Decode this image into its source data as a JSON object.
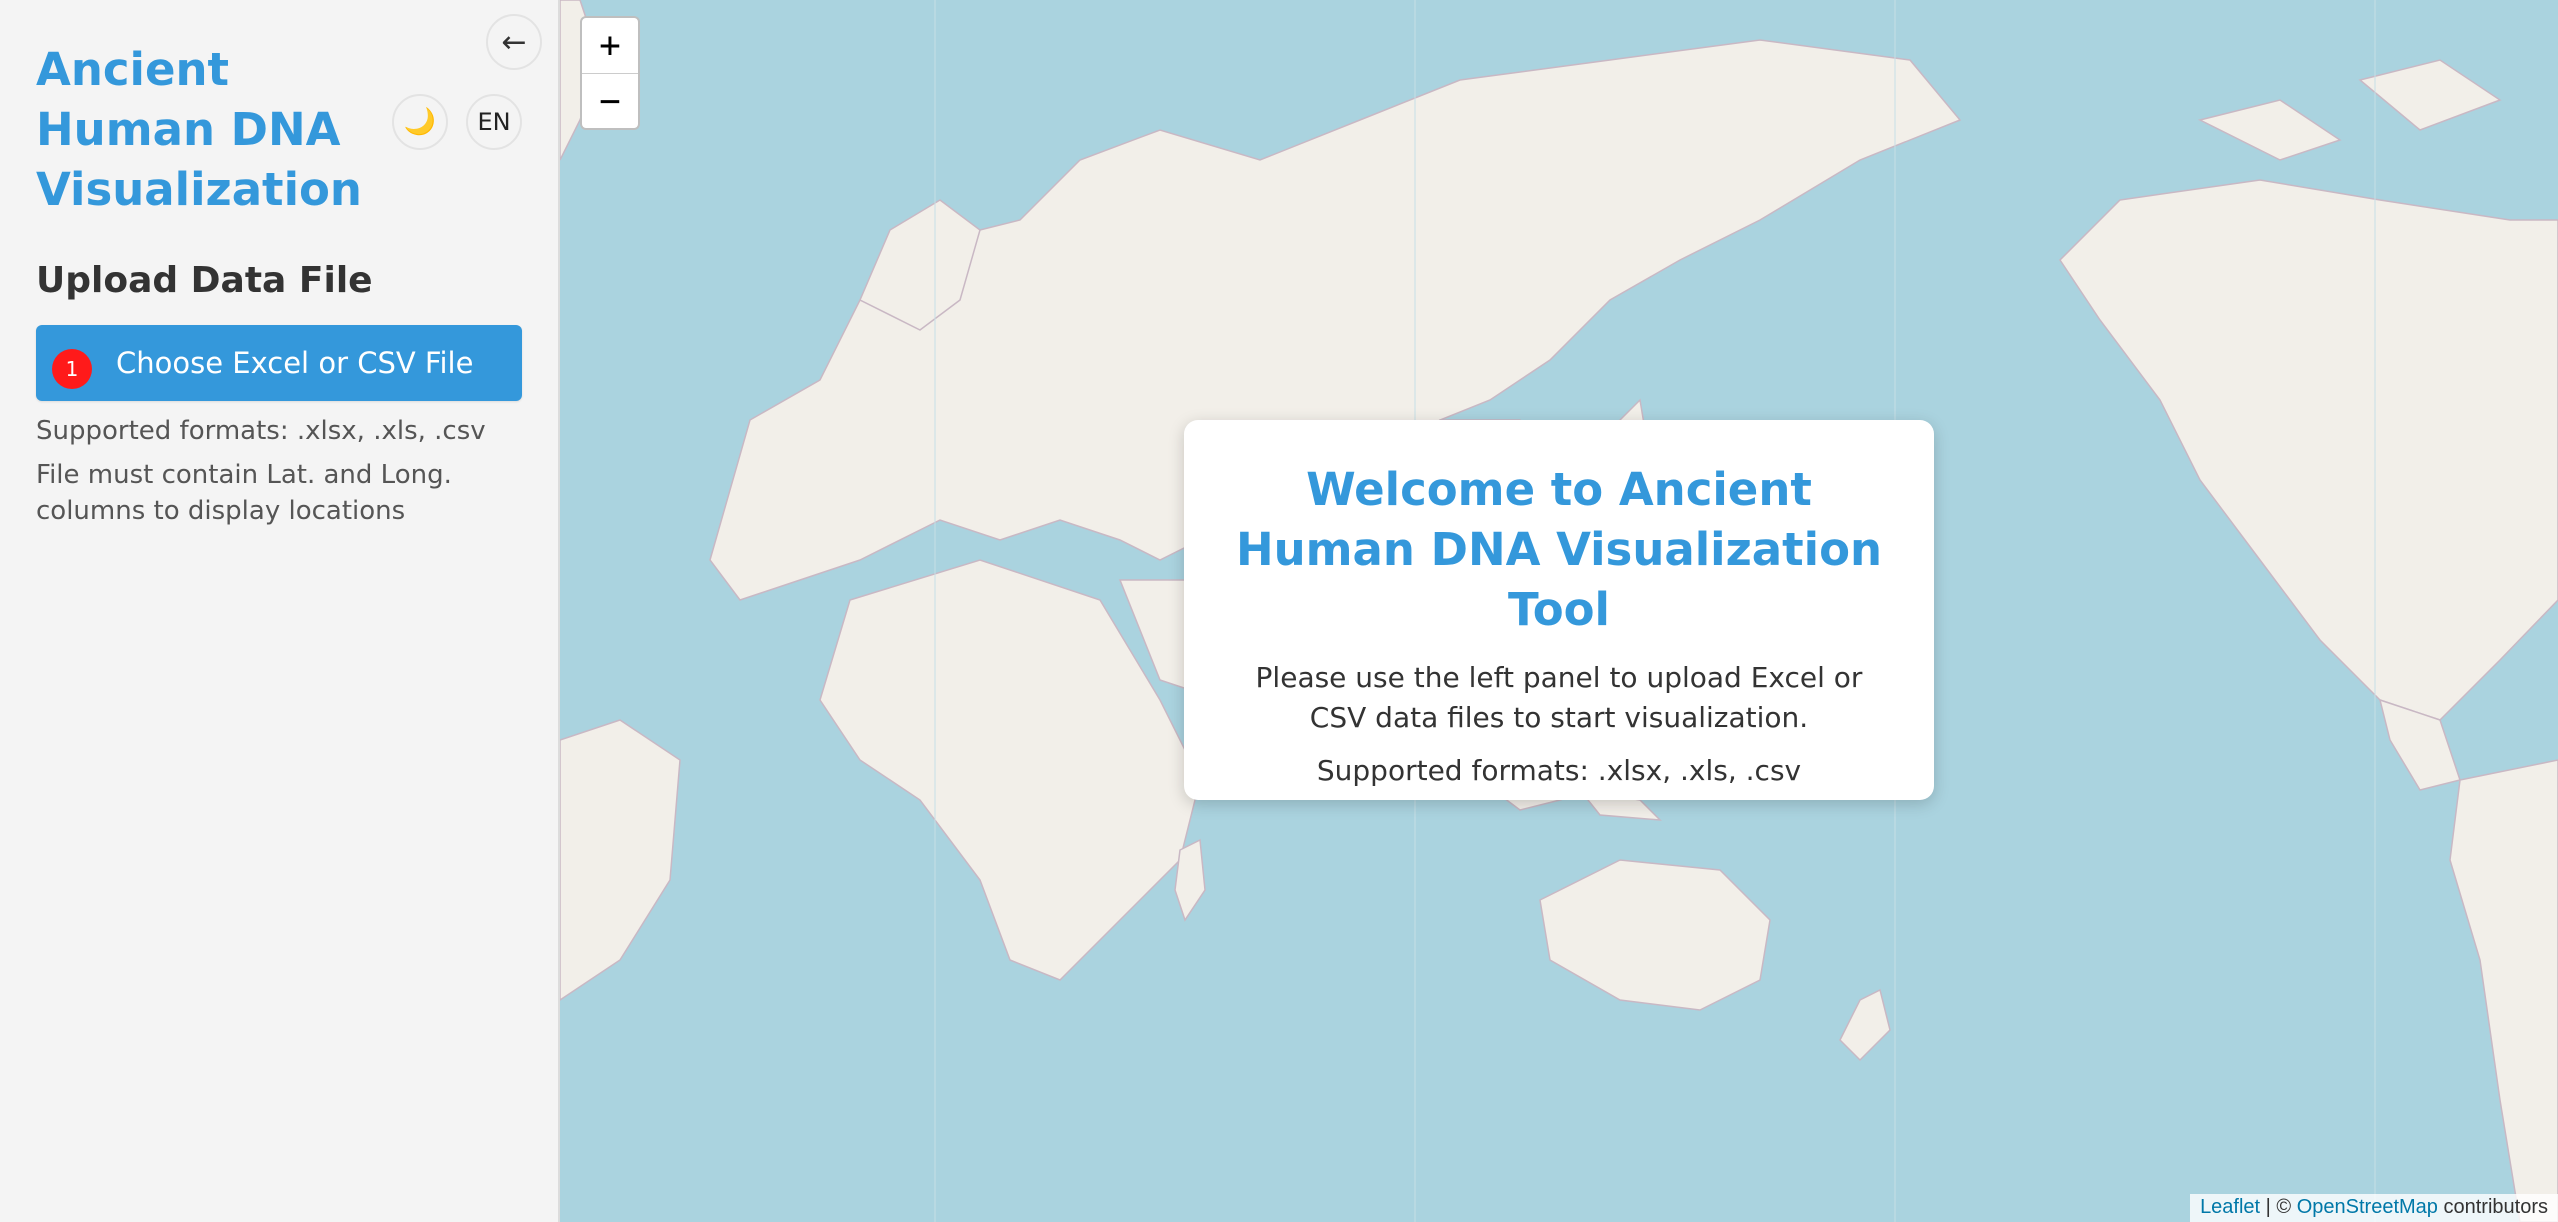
{
  "sidebar": {
    "collapse_symbol": "←",
    "title": "Ancient Human DNA Visualization",
    "theme_symbol": "🌙",
    "language": "EN",
    "upload": {
      "section_title": "Upload Data File",
      "badge": "1",
      "button_label": "Choose Excel or CSV File",
      "formats_hint": "Supported formats: .xlsx, .xls, .csv",
      "columns_hint": "File must contain Lat. and Long. columns to display locations"
    }
  },
  "map": {
    "zoom_in": "+",
    "zoom_out": "−",
    "welcome": {
      "title": "Welcome to Ancient Human DNA Visualization Tool",
      "text": "Please use the left panel to upload Excel or CSV data files to start visualization.",
      "formats": "Supported formats: .xlsx, .xls, .csv"
    },
    "attribution": {
      "leaflet": "Leaflet",
      "separator": " | © ",
      "osm": "OpenStreetMap",
      "contributors": " contributors"
    }
  },
  "colors": {
    "accent": "#3498db",
    "badge": "#ff1a1a",
    "sea": "#aad3df",
    "land": "#f2efe9"
  }
}
